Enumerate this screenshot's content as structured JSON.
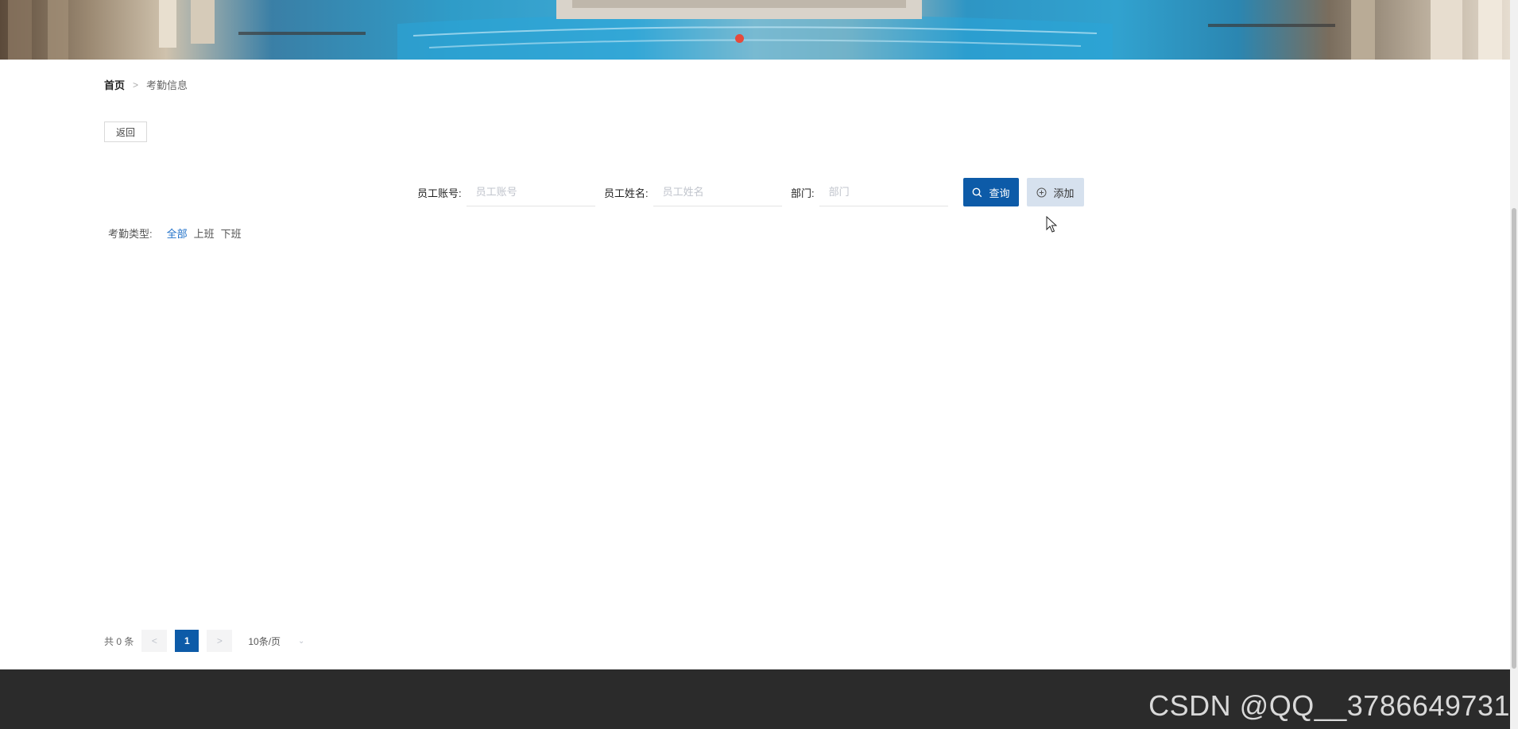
{
  "banner": {
    "carousel_dot_color": "#e64a3c"
  },
  "breadcrumb": {
    "home": "首页",
    "separator": ">",
    "current": "考勤信息"
  },
  "back_button": "返回",
  "search": {
    "account_label": "员工账号:",
    "account_placeholder": "员工账号",
    "name_label": "员工姓名:",
    "name_placeholder": "员工姓名",
    "dept_label": "部门:",
    "dept_placeholder": "部门",
    "search_button": "查询",
    "add_button": "添加"
  },
  "filter": {
    "label": "考勤类型:",
    "options": [
      "全部",
      "上班",
      "下班"
    ],
    "selected": "全部"
  },
  "pagination": {
    "total_text": "共 0 条",
    "prev": "<",
    "current_page": "1",
    "next": ">",
    "page_size": "10条/页"
  },
  "watermark": "CSDN @QQ__3786649731",
  "colors": {
    "primary": "#0d5ba8",
    "add_button_bg": "#d6e1ee",
    "active_filter": "#1e6fc8",
    "footer": "#2b2b2b"
  }
}
